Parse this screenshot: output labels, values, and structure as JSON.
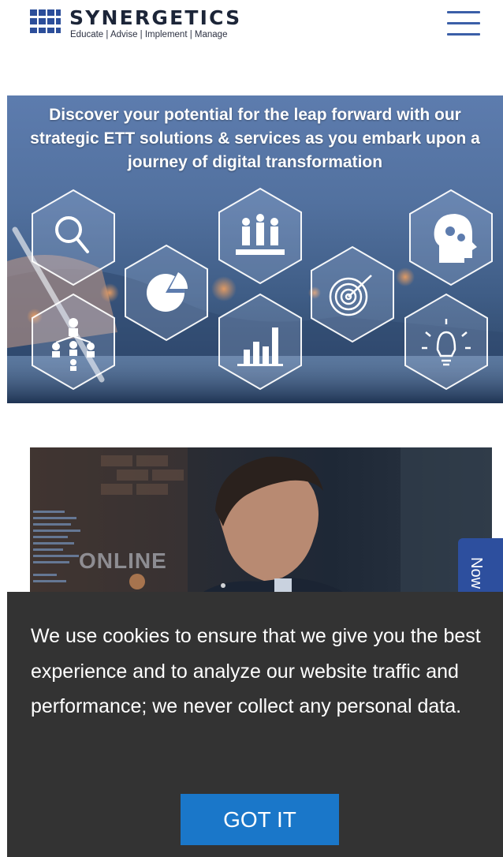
{
  "header": {
    "brand_name": "SYNERGETICS",
    "brand_tagline": "Educate | Advise | Implement | Manage",
    "menu_icon": "hamburger-menu-icon"
  },
  "hero": {
    "headline": "Discover your potential for the leap forward with our strategic ETT solutions & services as you embark upon a journey of digital transformation",
    "icons": [
      "magnifier-icon",
      "team-icon",
      "head-gears-icon",
      "pie-chart-icon",
      "target-icon",
      "org-chart-icon",
      "bar-chart-icon",
      "lightbulb-icon"
    ]
  },
  "photo": {
    "overlay_word": "ONLINE"
  },
  "side_tab": {
    "label": "Now"
  },
  "cookie_banner": {
    "message": "We use cookies to ensure that we give you the best experience and to analyze our website traffic and performance; we never collect any personal data.",
    "button_label": "GOT IT"
  },
  "colors": {
    "brand_navy": "#1c2538",
    "menu_blue": "#3b5fa8",
    "side_tab_blue": "#2d4f9e",
    "cookie_bg": "#333333",
    "button_blue": "#1a77c9"
  }
}
